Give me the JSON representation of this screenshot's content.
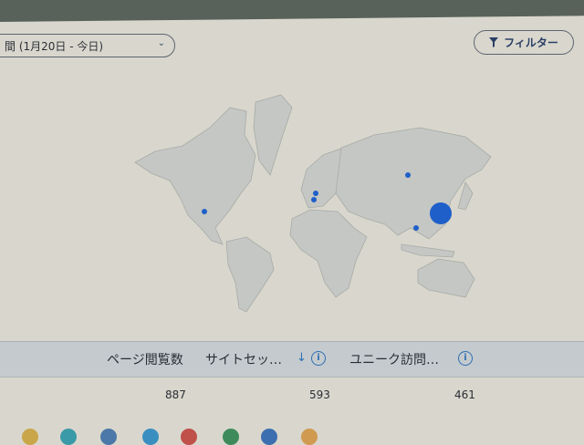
{
  "header": {
    "date_range_label": "間 (1月20日 - 今日)",
    "filter_label": "フィルター"
  },
  "map": {
    "marker_color": "#1f5fc9",
    "markers": [
      {
        "region": "United States",
        "relative_size": 1
      },
      {
        "region": "Europe (north)",
        "relative_size": 1
      },
      {
        "region": "Europe (south)",
        "relative_size": 1
      },
      {
        "region": "Russia",
        "relative_size": 1
      },
      {
        "region": "Japan",
        "relative_size": 4
      },
      {
        "region": "Southern China",
        "relative_size": 1
      }
    ]
  },
  "table": {
    "columns": [
      {
        "label": "ページ閲覧数"
      },
      {
        "label": "サイトセッ…",
        "sort": "descending"
      },
      {
        "label": "ユニーク訪問…"
      }
    ],
    "row": [
      "887",
      "593",
      "461"
    ]
  }
}
